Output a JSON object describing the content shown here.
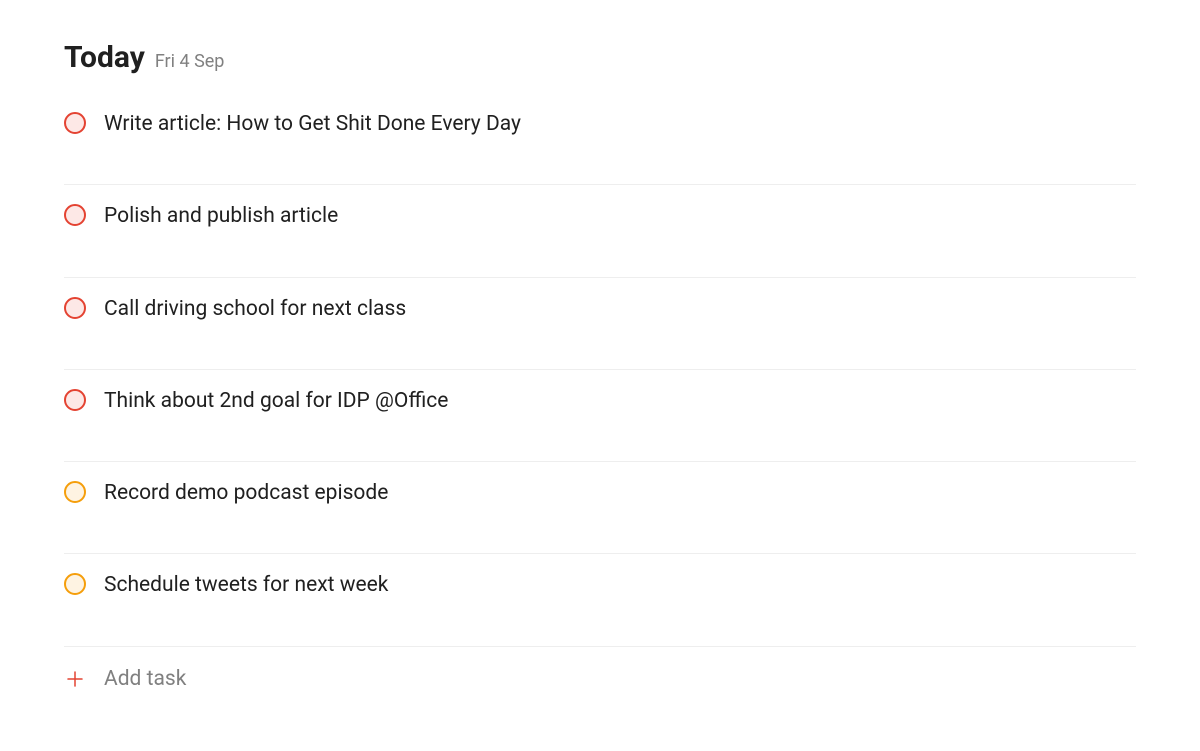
{
  "header": {
    "title": "Today",
    "date": "Fri 4 Sep"
  },
  "tasks": [
    {
      "title": "Write article: How to Get Shit Done Every Day",
      "priority": "high"
    },
    {
      "title": "Polish and publish article",
      "priority": "high"
    },
    {
      "title": "Call driving school for next class",
      "priority": "high"
    },
    {
      "title": "Think about 2nd goal for IDP @Office",
      "priority": "high"
    },
    {
      "title": "Record demo podcast episode",
      "priority": "medium"
    },
    {
      "title": "Schedule tweets for next week",
      "priority": "medium"
    }
  ],
  "addTask": {
    "label": "Add task"
  }
}
